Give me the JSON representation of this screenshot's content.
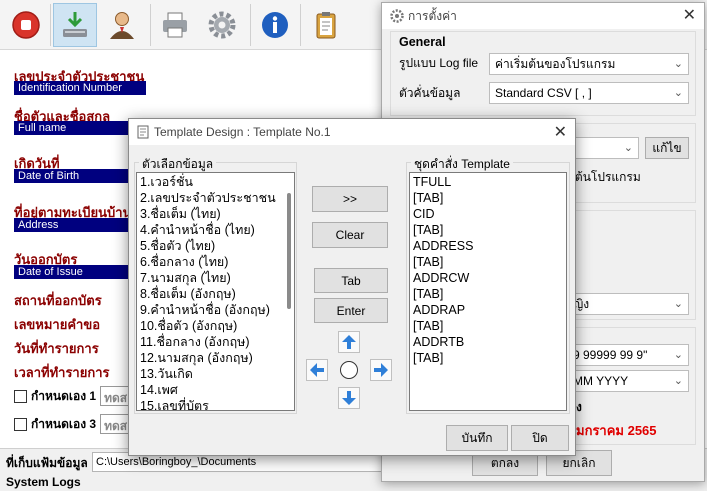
{
  "main": {
    "fields": [
      {
        "th": "เลขประจำตัวประชาชน",
        "en": "Identification Number"
      },
      {
        "th": "ชื่อตัวและชื่อสกุล",
        "en": "Full name"
      },
      {
        "th": "เกิดวันที่",
        "en": "Date of Birth"
      },
      {
        "th": "ที่อยู่ตามทะเบียนบ้าน",
        "en": "Address"
      },
      {
        "th": "วันออกบัตร",
        "en": "Date of Issue"
      }
    ],
    "plain_labels": [
      "สถานที่ออกบัตร",
      "เลขหมายคำขอ",
      "วันที่ทำรายการ",
      "เวลาที่ทำรายการ"
    ],
    "checkbox_rows": [
      {
        "label": "กำหนดเอง 1",
        "value": "ทดส"
      },
      {
        "label": "กำหนดเอง 3",
        "value": "ทดส"
      }
    ],
    "storage_label": "ที่เก็บแฟ้มข้อมูล",
    "storage_path": "C:\\Users\\Boringboy_\\Documents",
    "system_logs": "System Logs"
  },
  "settings": {
    "title": "การตั้งค่า",
    "general_header": "General",
    "log_format_label": "รูปแบบ Log file",
    "log_format_value": "ค่าเริ่มต้นของโปรแกรม",
    "delimiter_label": "ตัวคั่นข้อมูล",
    "delimiter_value": "Standard CSV [ , ]",
    "edit_button": "แก้ไข",
    "startup_text": "มต้นโปรแกรม",
    "gender_value": "ญิง",
    "id_format_value": "9 99999 99 9\"",
    "date_format_value": "MM YYYY",
    "bold_letter": "ง",
    "date_example": "มกราคม 2565",
    "ok_button": "ตกลง",
    "cancel_button": "ยกเลิก",
    "colors": {
      "date_example": "#e00000"
    }
  },
  "template_dialog": {
    "title": "Template Design : Template No.1",
    "left_caption": "ตัวเลือกข้อมูล",
    "right_caption": "ชุดคำสั่ง Template",
    "options": [
      "1.เวอร์ชั่น",
      "2.เลขประจำตัวประชาชน",
      "3.ชื่อเต็ม (ไทย)",
      "4.คำนำหน้าชื่อ (ไทย)",
      "5.ชื่อตัว (ไทย)",
      "6.ชื่อกลาง (ไทย)",
      "7.นามสกุล (ไทย)",
      "8.ชื่อเต็ม (อังกฤษ)",
      "9.คำนำหน้าชื่อ (อังกฤษ)",
      "10.ชื่อตัว (อังกฤษ)",
      "11.ชื่อกลาง (อังกฤษ)",
      "12.นามสกุล (อังกฤษ)",
      "13.วันเกิด",
      "14.เพศ",
      "15.เลขที่บัตร"
    ],
    "commands": [
      "TFULL",
      "[TAB]",
      "CID",
      "[TAB]",
      "ADDRESS",
      "[TAB]",
      "ADDRCW",
      "[TAB]",
      "ADDRAP",
      "[TAB]",
      "ADDRTB",
      "[TAB]"
    ],
    "add_button": ">>",
    "clear_button": "Clear",
    "tab_button": "Tab",
    "enter_button": "Enter",
    "save_button": "บันทึก",
    "close_button": "ปิด"
  }
}
